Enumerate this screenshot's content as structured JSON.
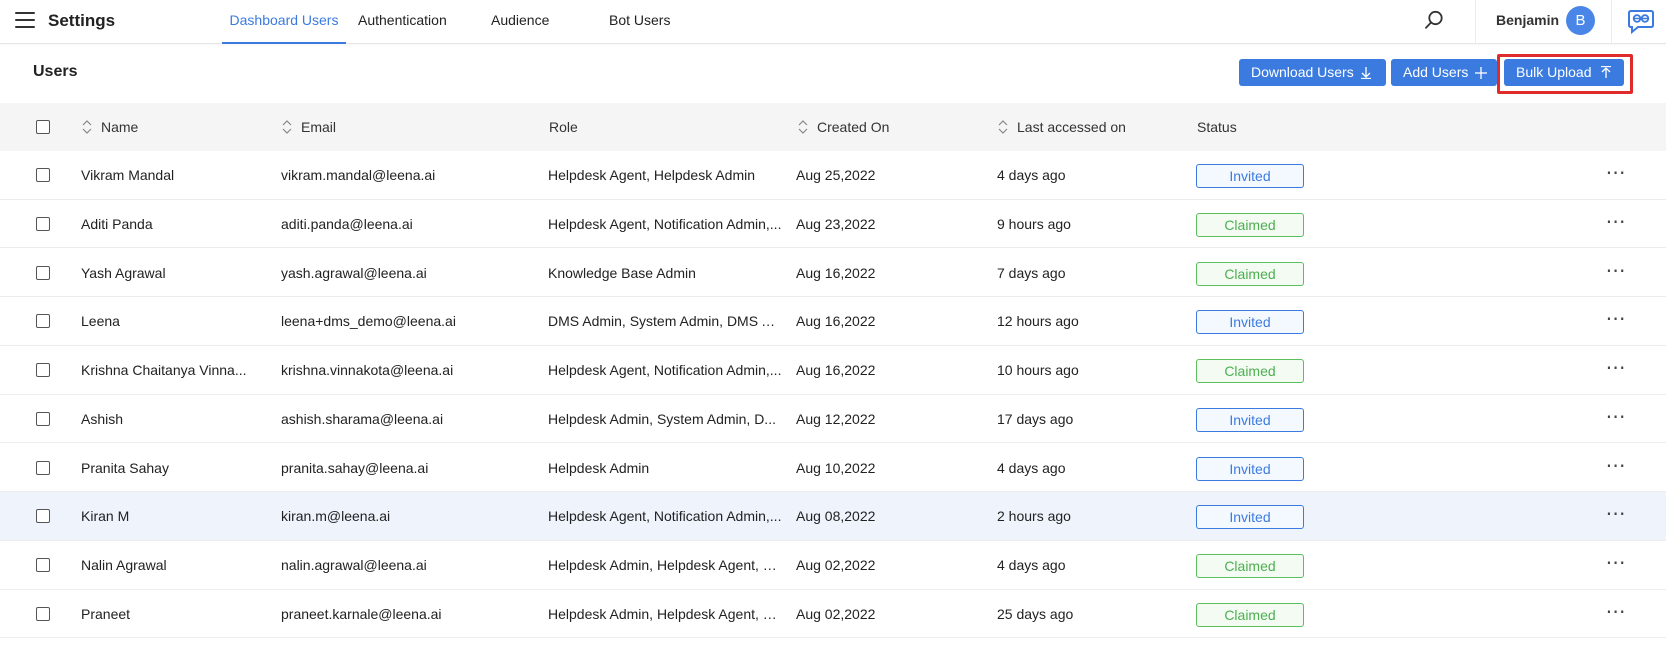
{
  "header": {
    "menu_icon": "hamburger-menu-icon",
    "title": "Settings",
    "tabs": [
      {
        "label": "Dashboard Users",
        "active": true
      },
      {
        "label": "Authentication",
        "active": false
      },
      {
        "label": "Audience",
        "active": false
      },
      {
        "label": "Bot Users",
        "active": false
      }
    ],
    "search_icon": "search-icon",
    "user_name": "Benjamin",
    "avatar_initial": "B",
    "brand_icon": "chat-bot-icon"
  },
  "page": {
    "title": "Users",
    "buttons": {
      "download": "Download Users",
      "add": "Add Users",
      "bulk_upload": "Bulk Upload"
    },
    "highlight_color": "#e02b2b"
  },
  "table": {
    "columns": {
      "name": "Name",
      "email": "Email",
      "role": "Role",
      "created_on": "Created On",
      "last_accessed": "Last accessed on",
      "status": "Status"
    },
    "rows": [
      {
        "name": "Vikram Mandal",
        "email": "vikram.mandal@leena.ai",
        "role": "Helpdesk Agent, Helpdesk Admin",
        "created_on": "Aug 25,2022",
        "last_accessed": "4 days ago",
        "status": "Invited"
      },
      {
        "name": "Aditi Panda",
        "email": "aditi.panda@leena.ai",
        "role": "Helpdesk Agent, Notification Admin,...",
        "created_on": "Aug 23,2022",
        "last_accessed": "9 hours ago",
        "status": "Claimed"
      },
      {
        "name": "Yash Agrawal",
        "email": "yash.agrawal@leena.ai",
        "role": "Knowledge Base Admin",
        "created_on": "Aug 16,2022",
        "last_accessed": "7 days ago",
        "status": "Claimed"
      },
      {
        "name": "Leena",
        "email": "leena+dms_demo@leena.ai",
        "role": "DMS Admin, System Admin, DMS Ag...",
        "created_on": "Aug 16,2022",
        "last_accessed": "12 hours ago",
        "status": "Invited"
      },
      {
        "name": "Krishna Chaitanya Vinna...",
        "email": "krishna.vinnakota@leena.ai",
        "role": "Helpdesk Agent, Notification Admin,...",
        "created_on": "Aug 16,2022",
        "last_accessed": "10 hours ago",
        "status": "Claimed"
      },
      {
        "name": "Ashish",
        "email": "ashish.sharama@leena.ai",
        "role": "Helpdesk Admin, System Admin, D...",
        "created_on": "Aug 12,2022",
        "last_accessed": "17 days ago",
        "status": "Invited"
      },
      {
        "name": "Pranita Sahay",
        "email": "pranita.sahay@leena.ai",
        "role": "Helpdesk Admin",
        "created_on": "Aug 10,2022",
        "last_accessed": "4 days ago",
        "status": "Invited"
      },
      {
        "name": "Kiran M",
        "email": "kiran.m@leena.ai",
        "role": "Helpdesk Agent, Notification Admin,...",
        "created_on": "Aug 08,2022",
        "last_accessed": "2 hours ago",
        "status": "Invited"
      },
      {
        "name": "Nalin Agrawal",
        "email": "nalin.agrawal@leena.ai",
        "role": "Helpdesk Admin, Helpdesk Agent, V...",
        "created_on": "Aug 02,2022",
        "last_accessed": "4 days ago",
        "status": "Claimed"
      },
      {
        "name": "Praneet",
        "email": "praneet.karnale@leena.ai",
        "role": "Helpdesk Admin, Helpdesk Agent, V...",
        "created_on": "Aug 02,2022",
        "last_accessed": "25 days ago",
        "status": "Claimed"
      }
    ],
    "selected_row_index": 7
  },
  "colors": {
    "accent": "#3b7be0",
    "invited": "#3b7be0",
    "claimed": "#4caf50",
    "selected_row": "#eef3fc"
  }
}
